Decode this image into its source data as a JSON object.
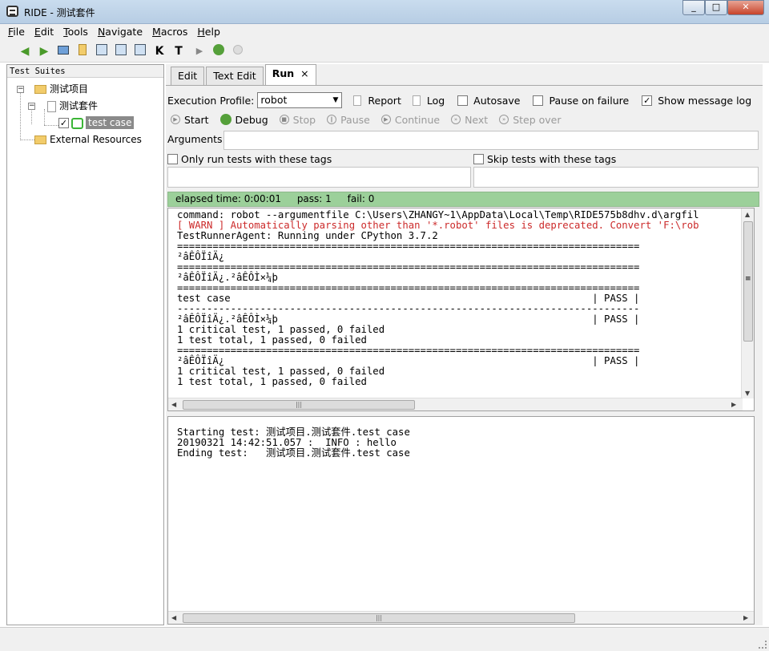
{
  "window": {
    "title": "RIDE - 测试套件",
    "minimize": "_",
    "maximize": "□",
    "close": "✕"
  },
  "menu": [
    {
      "key": "F",
      "rest": "ile"
    },
    {
      "key": "E",
      "rest": "dit"
    },
    {
      "key": "T",
      "rest": "ools"
    },
    {
      "key": "N",
      "rest": "avigate"
    },
    {
      "key": "M",
      "rest": "acros"
    },
    {
      "key": "H",
      "rest": "elp"
    }
  ],
  "toolbar": {
    "icons": [
      "back-arrow-icon",
      "forward-arrow-icon",
      "open-folder-icon",
      "open-directory-icon",
      "save-icon",
      "save-all-icon",
      "search-keywords-icon",
      "search-tests-icon",
      "run-icon",
      "debug-icon",
      "stop-icon"
    ],
    "k_label": "K",
    "t_label": "T"
  },
  "tree": {
    "header": "Test Suites",
    "project": "测试项目",
    "suite": "测试套件",
    "test_case": "test case",
    "test_checked": "✓",
    "external": "External Resources",
    "expander_minus": "−"
  },
  "tabs": [
    {
      "label": "Edit"
    },
    {
      "label": "Text Edit"
    },
    {
      "label": "Run",
      "close": "×"
    }
  ],
  "run": {
    "profile_label": "Execution Profile:",
    "profile_value": "robot",
    "report_label": "Report",
    "log_label": "Log",
    "autosave_label": "Autosave",
    "pause_on_failure_label": "Pause on failure",
    "show_message_log_label": "Show message log",
    "show_message_log_checked": "✓",
    "buttons": {
      "start": "Start",
      "debug": "Debug",
      "stop": "Stop",
      "pause": "Pause",
      "continue": "Continue",
      "next": "Next",
      "step_over": "Step over"
    },
    "arguments_label": "Arguments:",
    "only_run_tags_label": "Only run tests with these tags",
    "skip_tags_label": "Skip tests with these tags"
  },
  "status": {
    "elapsed": "elapsed time: 0:00:01",
    "pass": "pass: 1",
    "fail": "fail: 0",
    "color": "#9cd09a"
  },
  "console": {
    "line1": "command: robot --argumentfile C:\\Users\\ZHANGY~1\\AppData\\Local\\Temp\\RIDE575b8dhv.d\\argfil",
    "warn": "[ WARN ] Automatically parsing other than '*.robot' files is deprecated. Convert 'F:\\rob",
    "line3": "TestRunnerAgent: Running under CPython 3.7.2",
    "body": "\n==============================================================================\n²âÊÔÏîÄ¿\n==============================================================================\n²âÊÔÏîÄ¿.²âÊÔÌ×¼þ\n==============================================================================\ntest case                                                             | PASS |\n------------------------------------------------------------------------------\n²âÊÔÏîÄ¿.²âÊÔÌ×¼þ                                                     | PASS |\n1 critical test, 1 passed, 0 failed\n1 test total, 1 passed, 0 failed\n==============================================================================\n²âÊÔÏîÄ¿                                                              | PASS |\n1 critical test, 1 passed, 0 failed\n1 test total, 1 passed, 0 failed"
  },
  "message_log": {
    "text": "Starting test: 测试项目.测试套件.test case\n20190321 14:42:51.057 :  INFO : hello\nEnding test:   测试项目.测试套件.test case"
  },
  "scroll": {
    "grip": "≡",
    "left": "◀",
    "right": "▶",
    "up": "▲",
    "down": "▼",
    "hgrip": "|||"
  }
}
